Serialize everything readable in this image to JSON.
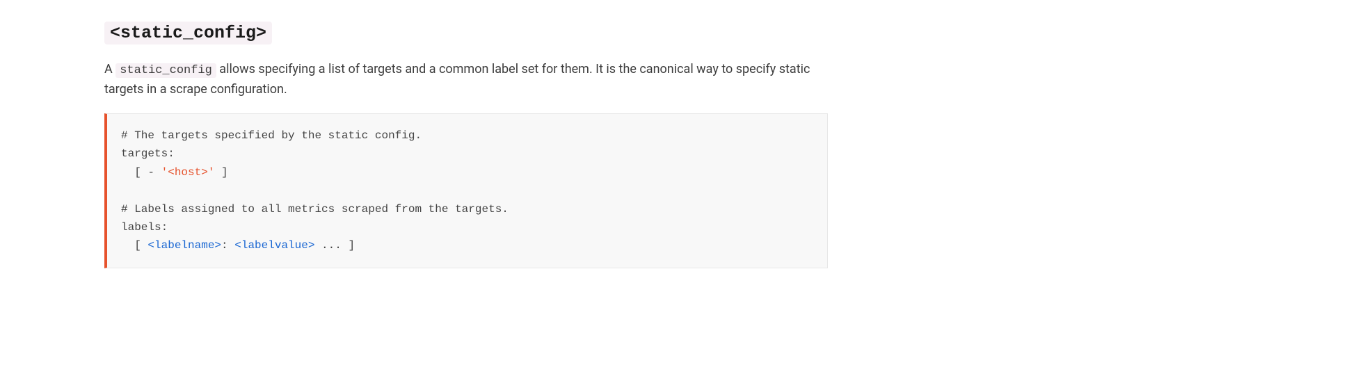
{
  "heading": {
    "code": "<static_config>"
  },
  "paragraph": {
    "pre_text": "A ",
    "inline_code": "static_config",
    "post_text": " allows specifying a list of targets and a common label set for them. It is the canonical way to specify static targets in a scrape configuration."
  },
  "code": {
    "l1": "# The targets specified by the static config.",
    "l2": "targets:",
    "l3_pre": "  [ - ",
    "l3_str": "'<host>'",
    "l3_post": " ]",
    "l4": "",
    "l5": "# Labels assigned to all metrics scraped from the targets.",
    "l6": "labels:",
    "l7_pre": "  [ ",
    "l7_ln": "<labelname>",
    "l7_sep": ": ",
    "l7_lv": "<labelvalue>",
    "l7_post": " ... ]"
  }
}
